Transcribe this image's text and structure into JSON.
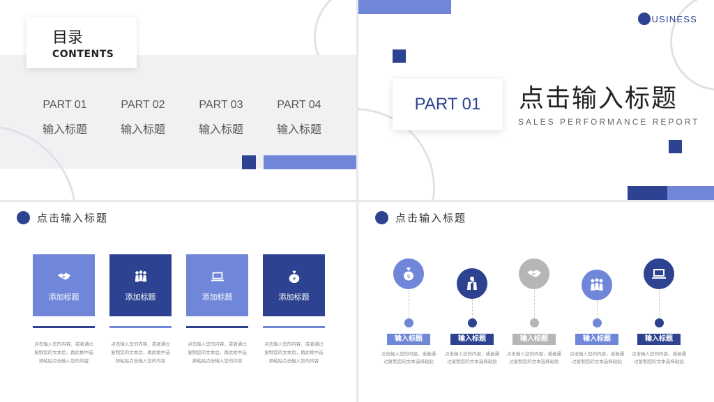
{
  "colors": {
    "navy": "#2d4391",
    "periwinkle": "#6f86d9",
    "gray": "#b6b6b9"
  },
  "slide1": {
    "toc_cn": "目录",
    "toc_en": "CONTENTS",
    "parts": [
      {
        "num": "PART 01",
        "title": "输入标题"
      },
      {
        "num": "PART 02",
        "title": "输入标题"
      },
      {
        "num": "PART 03",
        "title": "输入标题"
      },
      {
        "num": "PART 04",
        "title": "输入标题"
      }
    ]
  },
  "slide2": {
    "brand": "BUSINESS",
    "part": "PART 01",
    "title": "点击输入标题",
    "subtitle": "SALES PERFORMANCE REPORT"
  },
  "slide3": {
    "header": "点击输入标题",
    "cards": [
      {
        "icon": "handshake-icon",
        "label": "添加标题",
        "color": "periwinkle",
        "desc": "点击输入您的内容，或者通过复制您的文本后，再此框中选择粘贴点击输入您的内容"
      },
      {
        "icon": "team-icon",
        "label": "添加标题",
        "color": "navy",
        "desc": "点击输入您的内容，或者通过复制您的文本后，再此框中选择粘贴点击输入您的内容"
      },
      {
        "icon": "laptop-icon",
        "label": "添加标题",
        "color": "periwinkle",
        "desc": "点击输入您的内容，或者通过复制您的文本后，再此框中选择粘贴点击输入您的内容"
      },
      {
        "icon": "money-bag-icon",
        "label": "添加标题",
        "color": "navy",
        "desc": "点击输入您的内容，或者通过复制您的文本后，再此框中选择粘贴点击输入您的内容"
      }
    ]
  },
  "slide4": {
    "header": "点击输入标题",
    "items": [
      {
        "icon": "money-bag-icon",
        "label": "输入标题",
        "color": "periwinkle",
        "desc": "点击输入您的内容，或者通过复制您的文本选择粘贴"
      },
      {
        "icon": "team-icon",
        "label": "输入标题",
        "color": "navy",
        "desc": "点击输入您的内容，或者通过复制您的文本选择粘贴"
      },
      {
        "icon": "handshake-icon",
        "label": "输入标题",
        "color": "gray",
        "desc": "点击输入您的内容，或者通过复制您的文本选择粘贴"
      },
      {
        "icon": "team-icon",
        "label": "输入标题",
        "color": "periwinkle",
        "desc": "点击输入您的内容，或者通过复制您的文本选择粘贴"
      },
      {
        "icon": "laptop-icon",
        "label": "输入标题",
        "color": "navy",
        "desc": "点击输入您的内容，或者通过复制您的文本选择粘贴"
      }
    ]
  }
}
